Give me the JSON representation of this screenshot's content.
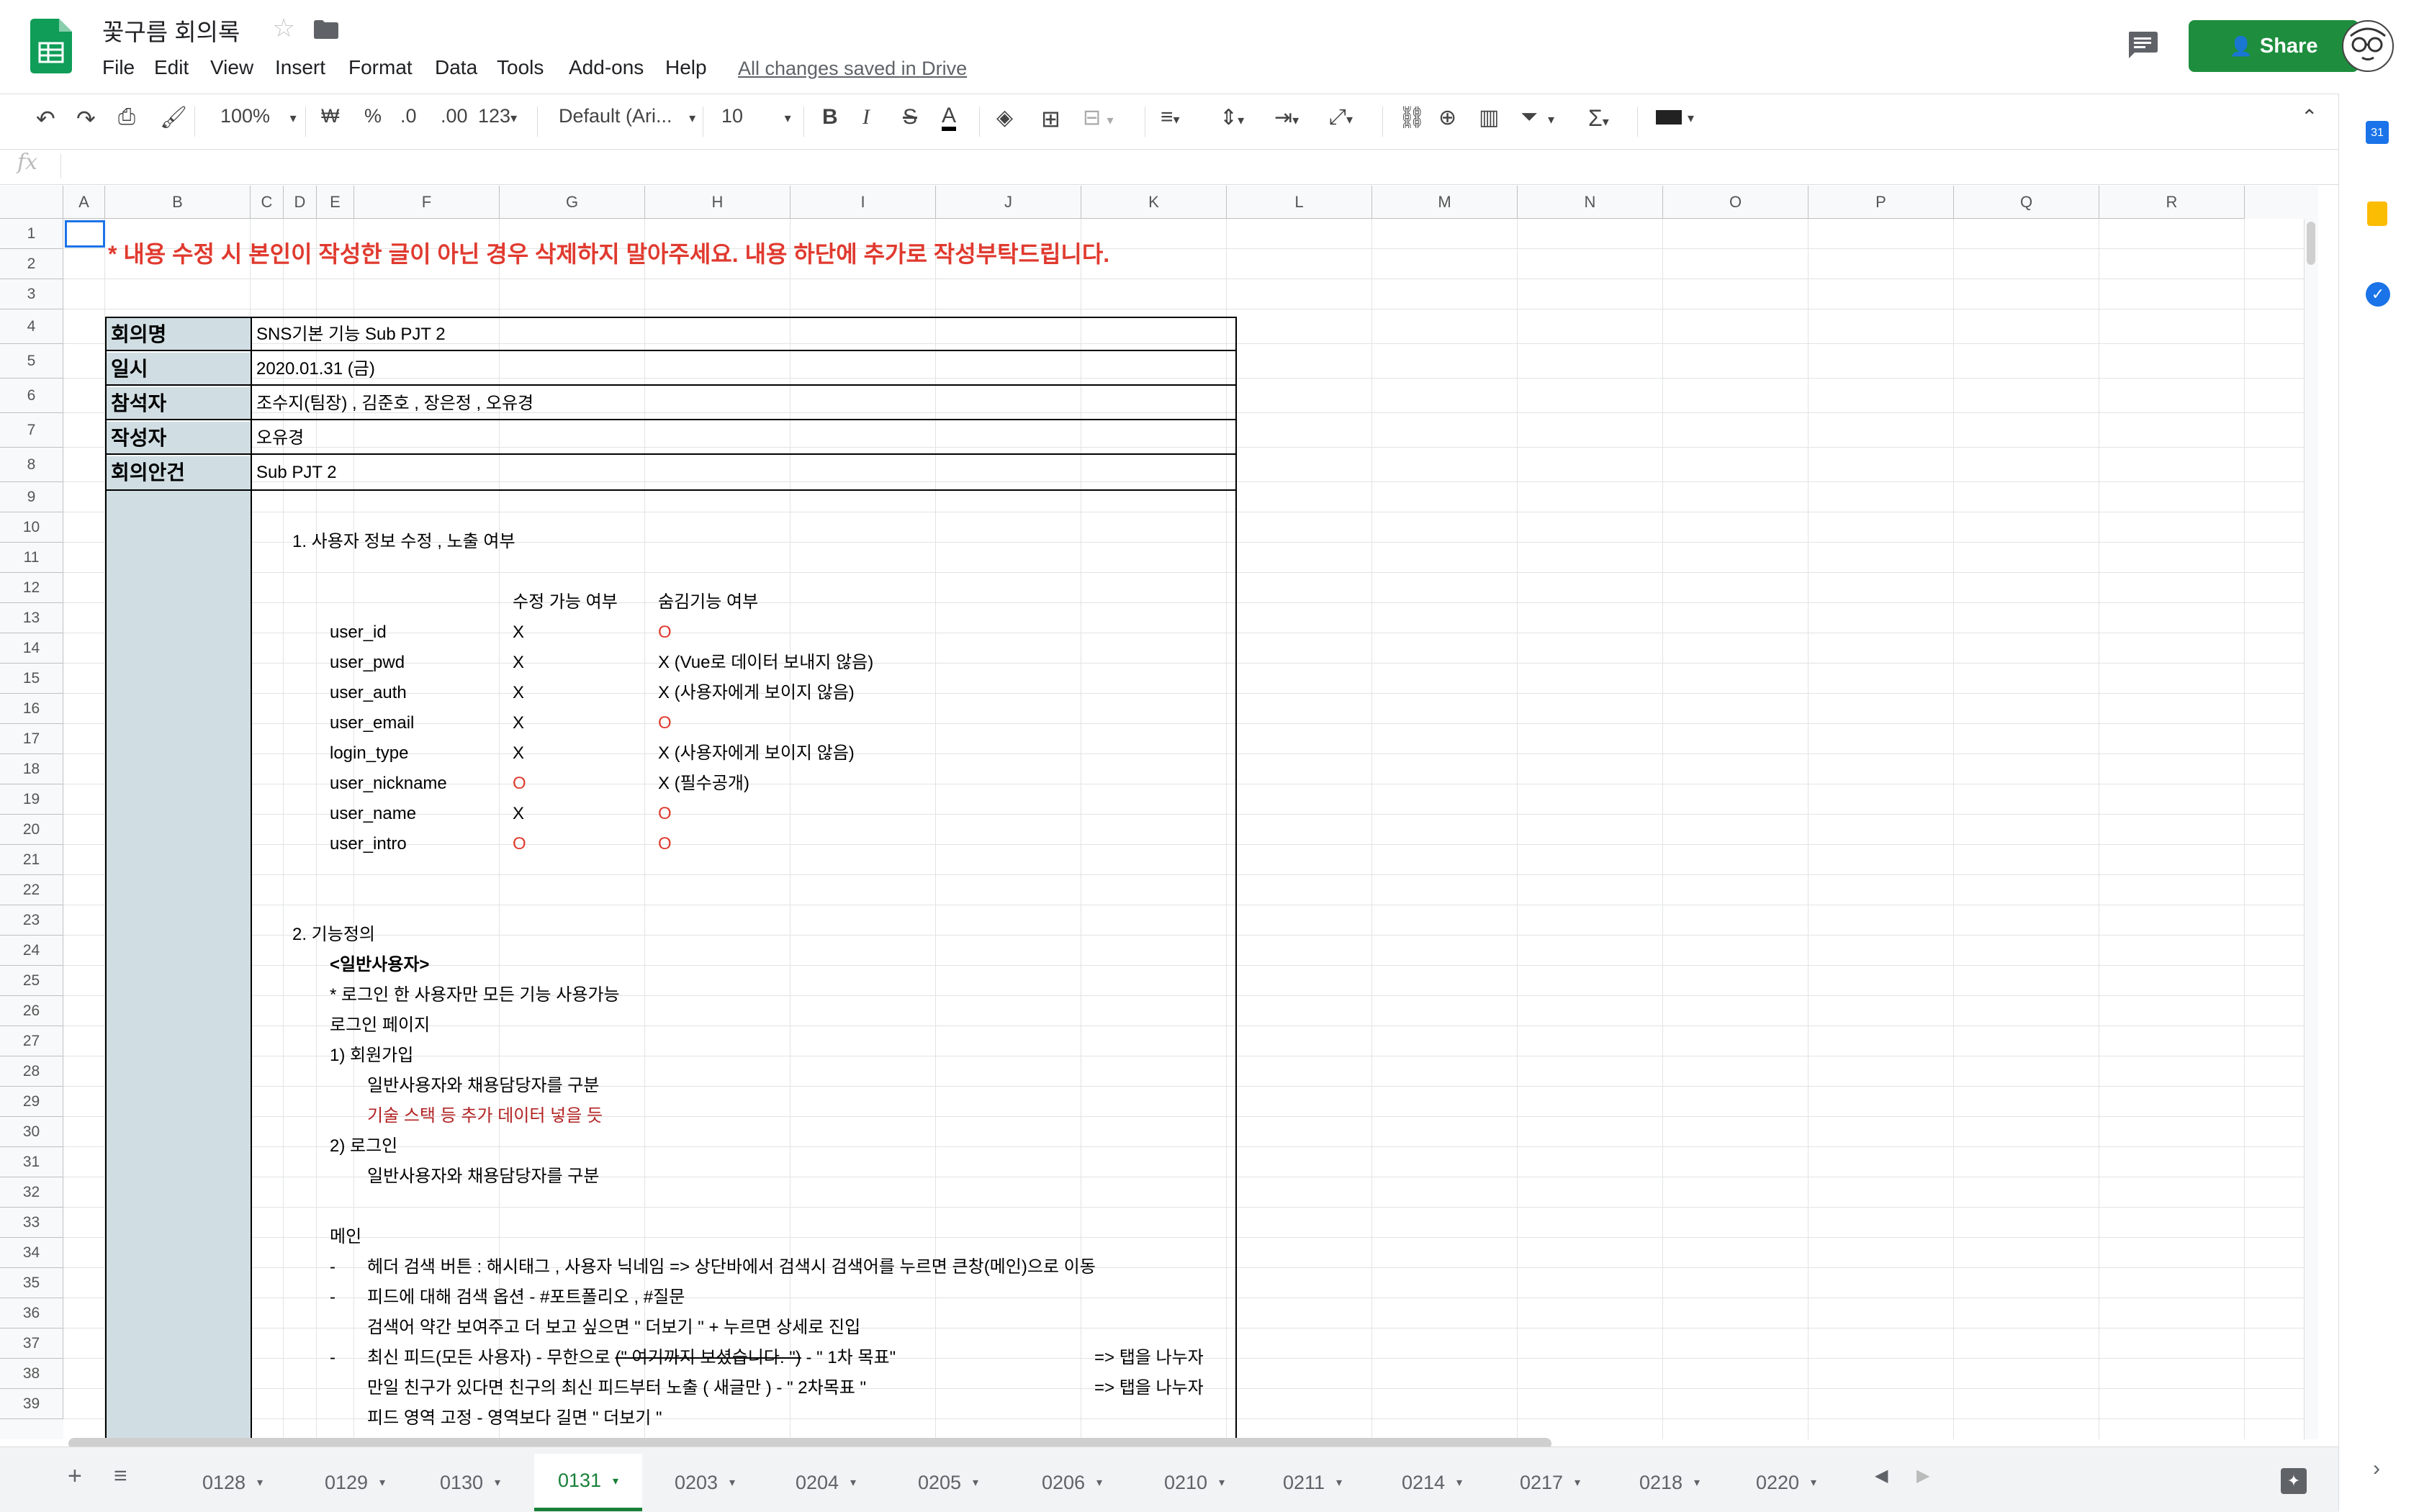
{
  "header": {
    "title": "꽃구름 회의록",
    "menus": [
      "File",
      "Edit",
      "View",
      "Insert",
      "Format",
      "Data",
      "Tools",
      "Add-ons",
      "Help"
    ],
    "saved_status": "All changes saved in Drive",
    "share_label": "Share"
  },
  "toolbar": {
    "zoom": "100%",
    "currency": "₩",
    "percent": "%",
    "dec_decrease": ".0",
    "dec_increase": ".00",
    "number_format": "123",
    "font": "Default (Ari...",
    "font_size": "10",
    "bold": "B",
    "italic": "I",
    "strike": "S",
    "text_color": "A",
    "sum": "Σ"
  },
  "formula": {
    "fx": "fx",
    "value": ""
  },
  "columns": [
    "A",
    "B",
    "C",
    "D",
    "E",
    "F",
    "G",
    "H",
    "I",
    "J",
    "K",
    "L",
    "M",
    "N",
    "O",
    "P",
    "Q",
    "R"
  ],
  "rows": [
    "1",
    "2",
    "3",
    "4",
    "5",
    "6",
    "7",
    "8",
    "9",
    "10",
    "11",
    "12",
    "13",
    "14",
    "15",
    "16",
    "17",
    "18",
    "19",
    "20",
    "21",
    "22",
    "23",
    "24",
    "25",
    "26",
    "27",
    "28",
    "29",
    "30",
    "31",
    "32",
    "33",
    "34",
    "35",
    "36",
    "37",
    "38",
    "39"
  ],
  "sheet": {
    "notice": "* 내용 수정 시 본인이 작성한 글이 아닌 경우 삭제하지 말아주세요. 내용 하단에 추가로 작성부탁드립니다.",
    "info": [
      {
        "label": "회의명",
        "value": "SNS기본 기능 Sub PJT 2"
      },
      {
        "label": "일시",
        "value": "2020.01.31 (금)"
      },
      {
        "label": "참석자",
        "value": "조수지(팀장) , 김준호 , 장은정 , 오유경"
      },
      {
        "label": "작성자",
        "value": "오유경"
      },
      {
        "label": "회의안건",
        "value": "Sub PJT 2"
      }
    ],
    "section1": "1. 사용자 정보 수정 , 노출 여부",
    "table_headers": {
      "editable": "수정 가능 여부",
      "hidden": "숨김기능 여부"
    },
    "fields": [
      {
        "name": "user_id",
        "editable": "X",
        "hidden": "O"
      },
      {
        "name": "user_pwd",
        "editable": "X",
        "hidden": "X (Vue로 데이터 보내지 않음)"
      },
      {
        "name": "user_auth",
        "editable": "X",
        "hidden": "X (사용자에게 보이지 않음)"
      },
      {
        "name": "user_email",
        "editable": "X",
        "hidden": "O"
      },
      {
        "name": "login_type",
        "editable": "X",
        "hidden": "X (사용자에게 보이지 않음)"
      },
      {
        "name": "user_nickname",
        "editable": "O",
        "hidden": "X (필수공개)"
      },
      {
        "name": "user_name",
        "editable": "X",
        "hidden": "O"
      },
      {
        "name": "user_intro",
        "editable": "O",
        "hidden": "O"
      }
    ],
    "section2": "2. 기능정의",
    "general_user": "<일반사용자>",
    "login_note": "* 로그인 한 사용자만 모든 기능 사용가능",
    "login_page": "로그인 페이지",
    "signup": "1) 회원가입",
    "signup_detail": "일반사용자와 채용담당자를 구분",
    "signup_extra": "기술 스택 등 추가 데이터 넣을 듯",
    "login": "2) 로그인",
    "login_detail": "일반사용자와 채용담당자를 구분",
    "main": "메인",
    "dash": "-",
    "main_items": [
      "헤더 검색 버튼 :  해시태그  , 사용자 닉네임 => 상단바에서 검색시 검색어를 누르면 큰창(메인)으로 이동",
      "피드에 대해 검색 옵션 - #포트폴리오 , #질문",
      "검색어 약간 보여주고 더 보고 싶으면 \" 더보기 \" + 누르면 상세로 진입"
    ],
    "row37_a": "최신 피드(모든 사용자) - 무한으로",
    "row37_strike": "(\" 여기까지 보셨습니다. \")",
    "row37_b": "- \" 1차 목표\"",
    "row37_tab": "=> 탭을 나누자",
    "row38": "만일 친구가 있다면 친구의 최신 피드부터 노출 ( 새글만 ) - \" 2차목표 \"",
    "row38_tab": "=> 탭을 나누자",
    "row39": "피드 영역 고정 - 영역보다 길면 \" 더보기 \""
  },
  "tabs": [
    "0128",
    "0129",
    "0130",
    "0131",
    "0203",
    "0204",
    "0205",
    "0206",
    "0210",
    "0211",
    "0214",
    "0217",
    "0218",
    "0220"
  ],
  "active_tab": "0131",
  "colors": {
    "accent": "#1e8e3e",
    "label_bg": "#d0dee3",
    "red": "#e03a2f",
    "dark_red": "#b22222"
  }
}
